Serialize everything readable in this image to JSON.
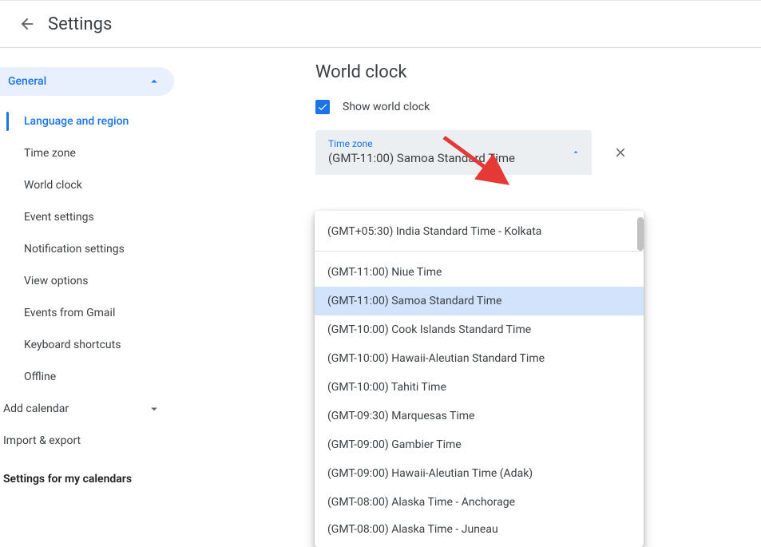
{
  "header": {
    "title": "Settings"
  },
  "sidebar": {
    "group_label": "General",
    "items": [
      "Language and region",
      "Time zone",
      "World clock",
      "Event settings",
      "Notification settings",
      "View options",
      "Events from Gmail",
      "Keyboard shortcuts",
      "Offline"
    ],
    "active_index": 0,
    "sections": [
      "Add calendar",
      "Import & export"
    ],
    "heading": "Settings for my calendars"
  },
  "main": {
    "title": "World clock",
    "checkbox_label": "Show world clock",
    "checkbox_checked": true,
    "tz_field_label": "Time zone",
    "tz_value": "(GMT-11:00) Samoa Standard Time"
  },
  "dropdown": {
    "recent": "(GMT+05:30) India Standard Time - Kolkata",
    "options": [
      "(GMT-11:00) Niue Time",
      "(GMT-11:00) Samoa Standard Time",
      "(GMT-10:00) Cook Islands Standard Time",
      "(GMT-10:00) Hawaii-Aleutian Standard Time",
      "(GMT-10:00) Tahiti Time",
      "(GMT-09:30) Marquesas Time",
      "(GMT-09:00) Gambier Time",
      "(GMT-09:00) Hawaii-Aleutian Time (Adak)",
      "(GMT-08:00) Alaska Time - Anchorage",
      "(GMT-08:00) Alaska Time - Juneau"
    ],
    "selected_index": 1
  }
}
